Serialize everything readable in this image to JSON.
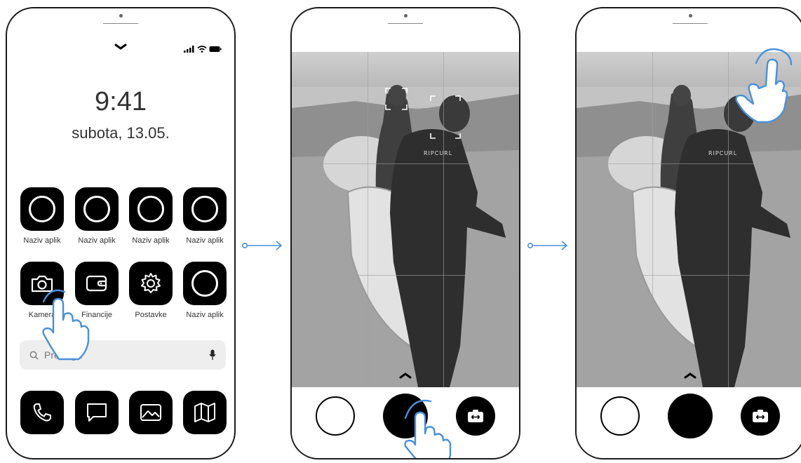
{
  "steps": [
    {
      "time": "9:41",
      "date": "subota, 13.05.",
      "apps_row1": [
        {
          "label": "Naziv aplik",
          "icon": "circle-icon"
        },
        {
          "label": "Naziv aplik",
          "icon": "circle-icon"
        },
        {
          "label": "Naziv aplik",
          "icon": "circle-icon"
        },
        {
          "label": "Naziv aplik",
          "icon": "circle-icon"
        }
      ],
      "apps_row2": [
        {
          "label": "Kamera",
          "icon": "camera-icon"
        },
        {
          "label": "Financije",
          "icon": "wallet-icon"
        },
        {
          "label": "Postavke",
          "icon": "gear-icon"
        },
        {
          "label": "Naziv aplik",
          "icon": "circle-icon"
        }
      ],
      "search": {
        "placeholder": "Pretraga"
      },
      "dock": [
        "phone-icon",
        "message-icon",
        "gallery-icon",
        "map-icon"
      ]
    },
    {
      "screen": "camera",
      "action": "tap-shutter"
    },
    {
      "screen": "camera",
      "action": "tap-top-right"
    }
  ],
  "colors": {
    "accent": "#4a90d9",
    "icon_bg": "#000000",
    "search_bg": "#eeeeee"
  }
}
